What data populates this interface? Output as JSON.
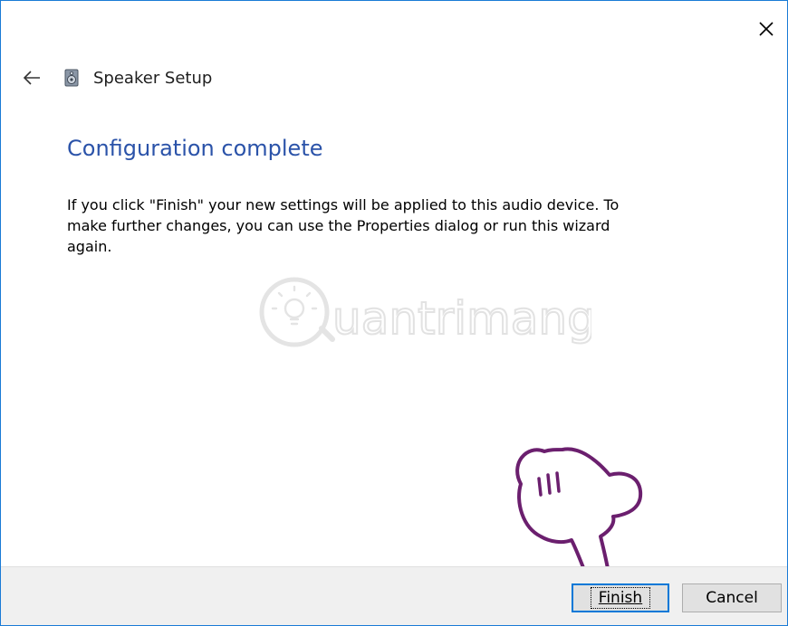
{
  "window": {
    "close_icon": "close-icon"
  },
  "header": {
    "back_icon": "back-arrow-icon",
    "app_icon": "speaker-icon",
    "title": "Speaker Setup"
  },
  "content": {
    "heading": "Configuration complete",
    "body": "If you click \"Finish\" your new settings will be applied to this audio device.  To\nmake further changes, you can use the Properties dialog or run this wizard\nagain."
  },
  "watermark": {
    "text": "uantrimang"
  },
  "footer": {
    "finish_label": "Finish",
    "cancel_label": "Cancel"
  },
  "colors": {
    "accent": "#0078d7",
    "heading": "#2b53a9",
    "window_border": "#1a7bd6",
    "footer_bg": "#f0f0f0",
    "hand_outline": "#6b1f6e"
  }
}
